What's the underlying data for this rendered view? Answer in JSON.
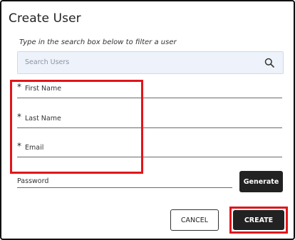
{
  "dialog": {
    "title": "Create User",
    "hint": "Type in the search box below to filter a user",
    "search": {
      "placeholder": "Search Users",
      "icon": "search-icon"
    },
    "fields": {
      "first_name": {
        "label": "First Name",
        "required_mark": "*"
      },
      "last_name": {
        "label": "Last Name",
        "required_mark": "*"
      },
      "email": {
        "label": "Email",
        "required_mark": "*"
      },
      "password": {
        "label": "Password"
      }
    },
    "buttons": {
      "generate": "Generate",
      "cancel": "CANCEL",
      "create": "CREATE"
    }
  },
  "colors": {
    "highlight": "#e0161a",
    "primary_button": "#222222",
    "search_bg": "#eef3fb"
  }
}
